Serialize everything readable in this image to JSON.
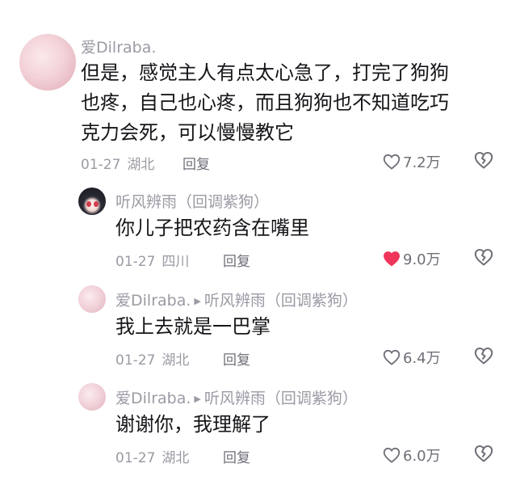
{
  "comments": [
    {
      "author": "爱Dilraba.",
      "text_lines": [
        "但是，感觉主人有点太心急了，打完了狗狗",
        "也疼，自己也心疼，而且狗狗也不知道吃巧",
        "克力会死，可以慢慢教它"
      ],
      "date": "01-27",
      "location": "湖北",
      "reply_label": "回复",
      "likes": "7.2万",
      "liked": false
    },
    {
      "author": "听风辨雨（回调紫狗）",
      "text": "你儿子把农药含在嘴里",
      "date": "01-27",
      "location": "四川",
      "reply_label": "回复",
      "likes": "9.0万",
      "liked": true
    },
    {
      "author": "爱Dilraba.",
      "reply_to": "听风辨雨（回调紫狗）",
      "text": "我上去就是一巴掌",
      "date": "01-27",
      "location": "湖北",
      "reply_label": "回复",
      "likes": "6.4万",
      "liked": false
    },
    {
      "author": "爱Dilraba.",
      "reply_to": "听风辨雨（回调紫狗）",
      "text": "谢谢你，我理解了",
      "date": "01-27",
      "location": "湖北",
      "reply_label": "回复",
      "likes": "6.0万",
      "liked": false
    }
  ],
  "colors": {
    "liked_heart": "#f0355a",
    "meta_gray": "#9a9aa4",
    "text": "#16161a"
  },
  "icons": {
    "like": "heart-outline-icon",
    "liked": "heart-filled-icon",
    "dislike": "broken-heart-icon",
    "reply_arrow": "triangle-right-icon"
  }
}
